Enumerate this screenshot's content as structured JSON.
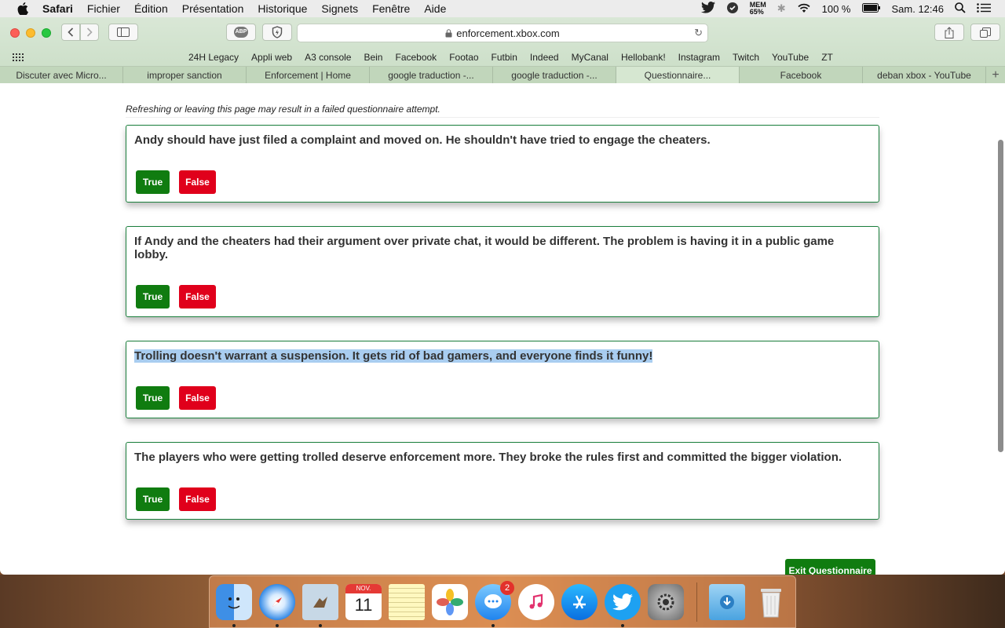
{
  "menubar": {
    "app": "Safari",
    "items": [
      "Fichier",
      "Édition",
      "Présentation",
      "Historique",
      "Signets",
      "Fenêtre",
      "Aide"
    ],
    "mem_label": "MEM",
    "mem_value": "65%",
    "battery": "100 %",
    "clock": "Sam. 12:46"
  },
  "toolbar": {
    "url": "enforcement.xbox.com",
    "abp_label": "ABP"
  },
  "bookmarks": [
    "24H Legacy",
    "Appli web",
    "A3 console",
    "Bein",
    "Facebook",
    "Footao",
    "Futbin",
    "Indeed",
    "MyCanal",
    "Hellobank!",
    "Instagram",
    "Twitch",
    "YouTube",
    "ZT"
  ],
  "tabs": [
    {
      "label": "Discuter avec Micro..."
    },
    {
      "label": "improper sanction"
    },
    {
      "label": "Enforcement | Home"
    },
    {
      "label": "google traduction -..."
    },
    {
      "label": "google traduction -..."
    },
    {
      "label": "Questionnaire..."
    },
    {
      "label": "Facebook"
    },
    {
      "label": "deban xbox - YouTube"
    }
  ],
  "page": {
    "notice": "Refreshing or leaving this page may result in a failed questionnaire attempt.",
    "true_label": "True",
    "false_label": "False",
    "questions": [
      {
        "text": "Andy should have just filed a complaint and moved on. He shouldn't have tried to engage the cheaters."
      },
      {
        "text": "If Andy and the cheaters had their argument over private chat, it would be different. The problem is having it in a public game lobby."
      },
      {
        "text": "Trolling doesn't warrant a suspension. It gets rid of bad gamers, and everyone finds it funny!"
      },
      {
        "text": "The players who were getting trolled deserve enforcement more. They broke the rules first and committed the bigger violation."
      }
    ],
    "exit_label": "Exit Questionnaire"
  },
  "dock": {
    "calendar_month": "NOV.",
    "calendar_day": "11",
    "messages_badge": "2"
  }
}
